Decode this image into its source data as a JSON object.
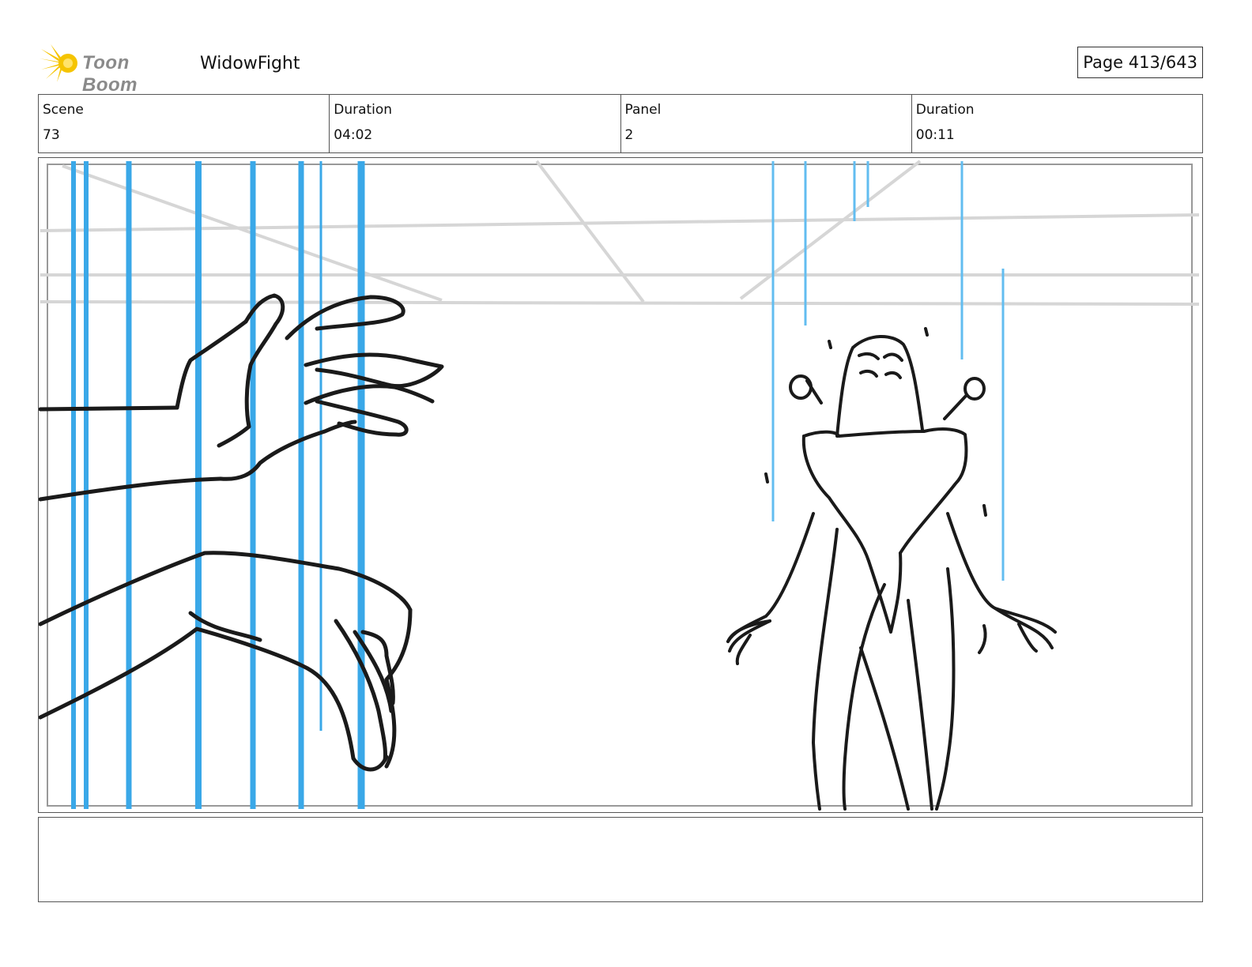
{
  "header": {
    "logo_text": "Toon Boom",
    "project_title": "WidowFight",
    "page_label": "Page 413/643"
  },
  "meta": [
    {
      "label": "Scene",
      "value": "73"
    },
    {
      "label": "Duration",
      "value": "04:02"
    },
    {
      "label": "Panel",
      "value": "2"
    },
    {
      "label": "Duration",
      "value": "00:11"
    }
  ],
  "panel": {
    "accent_color": "#3aa8e8",
    "line_color": "#111111",
    "background_line_color": "#d6d6d6"
  },
  "notes": {
    "text": ""
  }
}
